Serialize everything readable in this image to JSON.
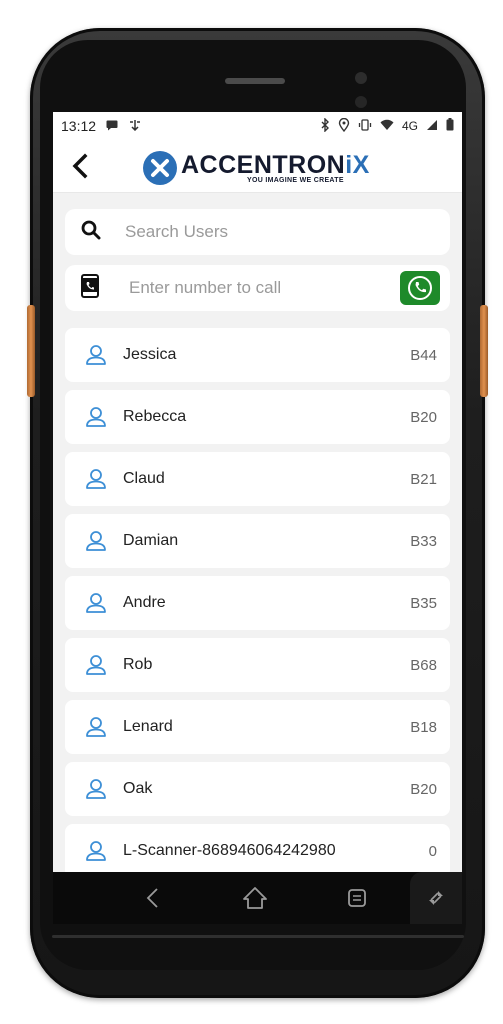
{
  "status_bar": {
    "time": "13:12",
    "network": "4G"
  },
  "header": {
    "logo_word_main": "ACCENTRON",
    "logo_word_accent": "iX",
    "logo_tagline": "YOU IMAGINE WE CREATE"
  },
  "search": {
    "placeholder": "Search Users"
  },
  "dial": {
    "placeholder": "Enter number to call"
  },
  "users": [
    {
      "name": "Jessica",
      "ext": "B44"
    },
    {
      "name": "Rebecca",
      "ext": "B20"
    },
    {
      "name": "Claud",
      "ext": "B21"
    },
    {
      "name": "Damian",
      "ext": "B33"
    },
    {
      "name": "Andre",
      "ext": "B35"
    },
    {
      "name": "Rob",
      "ext": "B68"
    },
    {
      "name": "Lenard",
      "ext": "B18"
    },
    {
      "name": "Oak",
      "ext": "B20"
    },
    {
      "name": "L-Scanner-868946064242980",
      "ext": "0"
    }
  ],
  "colors": {
    "brand_blue": "#2b6fb6",
    "call_green": "#1e8a2a",
    "user_icon_blue": "#3d8fd6"
  },
  "icons": {
    "back": "chevron-left-icon",
    "search": "search-icon",
    "dial": "phone-device-icon",
    "call": "phone-icon",
    "user": "user-icon",
    "nav_back": "nav-back-icon",
    "nav_home": "nav-home-icon",
    "nav_recents": "nav-recents-icon",
    "rotate": "rotate-icon"
  }
}
